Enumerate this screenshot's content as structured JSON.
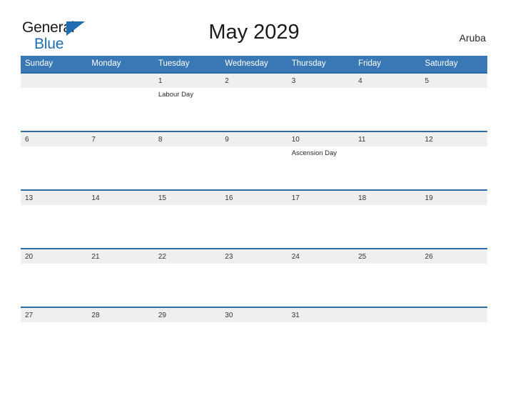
{
  "brand": {
    "line1": "General",
    "line2": "Blue",
    "triangle_color": "#1f6cb0",
    "text_color": "#1a1a1a"
  },
  "header": {
    "title": "May 2029",
    "region": "Aruba"
  },
  "theme": {
    "header_blue": "#3a78b5",
    "row_border_blue": "#2e6da4",
    "date_band_gray": "#efefef",
    "page_background": "#ffffff",
    "text_color": "#2b2b2b"
  },
  "calendar": {
    "month": "May",
    "year": "2029",
    "weekday_headers": [
      "Sunday",
      "Monday",
      "Tuesday",
      "Wednesday",
      "Thursday",
      "Friday",
      "Saturday"
    ],
    "weeks": [
      [
        {
          "date": "",
          "event": ""
        },
        {
          "date": "",
          "event": ""
        },
        {
          "date": "1",
          "event": "Labour Day"
        },
        {
          "date": "2",
          "event": ""
        },
        {
          "date": "3",
          "event": ""
        },
        {
          "date": "4",
          "event": ""
        },
        {
          "date": "5",
          "event": ""
        }
      ],
      [
        {
          "date": "6",
          "event": ""
        },
        {
          "date": "7",
          "event": ""
        },
        {
          "date": "8",
          "event": ""
        },
        {
          "date": "9",
          "event": ""
        },
        {
          "date": "10",
          "event": "Ascension Day"
        },
        {
          "date": "11",
          "event": ""
        },
        {
          "date": "12",
          "event": ""
        }
      ],
      [
        {
          "date": "13",
          "event": ""
        },
        {
          "date": "14",
          "event": ""
        },
        {
          "date": "15",
          "event": ""
        },
        {
          "date": "16",
          "event": ""
        },
        {
          "date": "17",
          "event": ""
        },
        {
          "date": "18",
          "event": ""
        },
        {
          "date": "19",
          "event": ""
        }
      ],
      [
        {
          "date": "20",
          "event": ""
        },
        {
          "date": "21",
          "event": ""
        },
        {
          "date": "22",
          "event": ""
        },
        {
          "date": "23",
          "event": ""
        },
        {
          "date": "24",
          "event": ""
        },
        {
          "date": "25",
          "event": ""
        },
        {
          "date": "26",
          "event": ""
        }
      ],
      [
        {
          "date": "27",
          "event": ""
        },
        {
          "date": "28",
          "event": ""
        },
        {
          "date": "29",
          "event": ""
        },
        {
          "date": "30",
          "event": ""
        },
        {
          "date": "31",
          "event": ""
        },
        {
          "date": "",
          "event": ""
        },
        {
          "date": "",
          "event": ""
        }
      ]
    ]
  }
}
